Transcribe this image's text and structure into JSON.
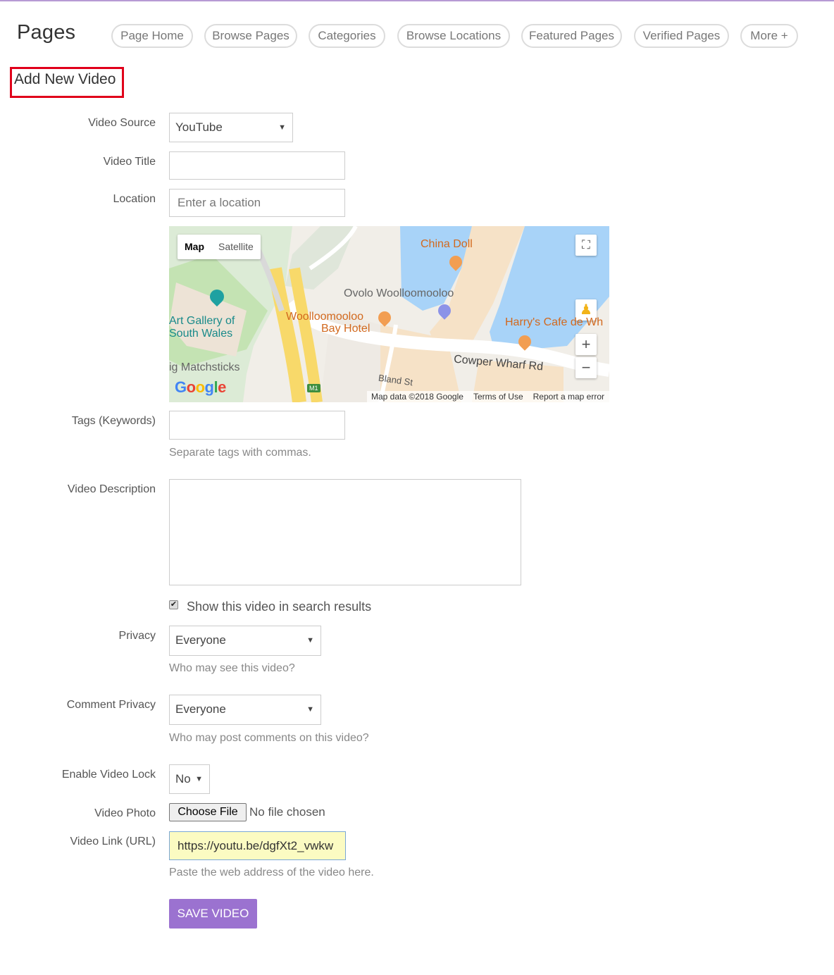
{
  "header": {
    "title": "Pages",
    "nav": [
      "Page Home",
      "Browse Pages",
      "Categories",
      "Browse Locations",
      "Featured Pages",
      "Verified Pages",
      "More +"
    ]
  },
  "form": {
    "heading": "Add New Video",
    "video_source": {
      "label": "Video Source",
      "value": "YouTube"
    },
    "video_title": {
      "label": "Video Title",
      "value": ""
    },
    "location": {
      "label": "Location",
      "placeholder": "Enter a location"
    },
    "map": {
      "type_map": "Map",
      "type_satellite": "Satellite",
      "places": [
        "China Doll",
        "Ovolo Woolloomooloo",
        "Harry's Cafe de Wh",
        "Art Gallery of",
        "South Wales",
        "Woolloomooloo",
        "Bay Hotel",
        "Cowper Wharf Rd",
        "ig Matchsticks",
        "Bland St"
      ],
      "road_marker": "M1",
      "logo": "Google",
      "footer": [
        "Map data ©2018 Google",
        "Terms of Use",
        "Report a map error"
      ],
      "zoom_in": "+",
      "zoom_out": "−"
    },
    "tags": {
      "label": "Tags (Keywords)",
      "value": "",
      "hint": "Separate tags with commas."
    },
    "description": {
      "label": "Video Description",
      "value": ""
    },
    "search_results": {
      "label": "Show this video in search results",
      "checked": true
    },
    "privacy": {
      "label": "Privacy",
      "value": "Everyone",
      "hint": "Who may see this video?"
    },
    "comment_privacy": {
      "label": "Comment Privacy",
      "value": "Everyone",
      "hint": "Who may post comments on this video?"
    },
    "video_lock": {
      "label": "Enable Video Lock",
      "value": "No"
    },
    "video_photo": {
      "label": "Video Photo",
      "button": "Choose File",
      "status": "No file chosen"
    },
    "video_link": {
      "label": "Video Link (URL)",
      "value": "https://youtu.be/dgfXt2_vwkw",
      "hint": "Paste the web address of the video here."
    },
    "save": "SAVE VIDEO"
  },
  "colors": {
    "accent": "#9b72d0",
    "highlight_border": "#e0001a",
    "autofill": "#fbfbc2"
  }
}
